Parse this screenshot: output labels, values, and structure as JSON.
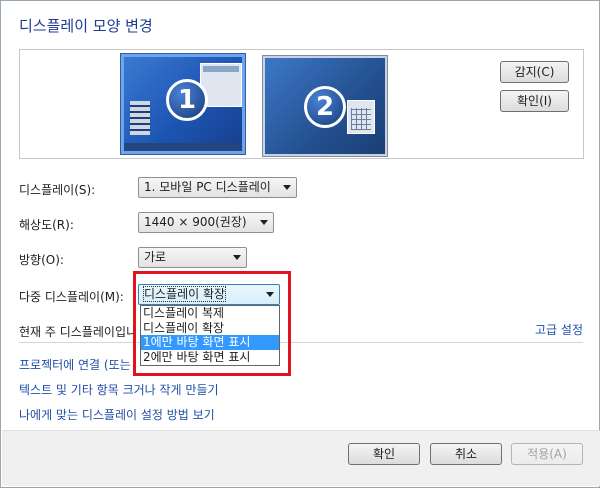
{
  "title": "디스플레이 모양 변경",
  "monitors": [
    {
      "number": "1",
      "selected": true
    },
    {
      "number": "2",
      "selected": false
    }
  ],
  "buttons": {
    "detect": "감지(C)",
    "identify": "확인(I)"
  },
  "fields": {
    "display": {
      "label": "디스플레이(S):",
      "value": "1. 모바일 PC 디스플레이"
    },
    "resolution": {
      "label": "해상도(R):",
      "value": "1440 × 900(권장)"
    },
    "orientation": {
      "label": "방향(O):",
      "value": "가로"
    },
    "multiple": {
      "label": "다중 디스플레이(M):",
      "value": "디스플레이 확장"
    }
  },
  "dropdown_options": [
    "디스플레이 복제",
    "디스플레이 확장",
    "1에만 바탕 화면 표시",
    "2에만 바탕 화면 표시"
  ],
  "dropdown_selected_index": 2,
  "main_display_text": "현재 주 디스플레이입니",
  "advanced_link": "고급 설정",
  "links": {
    "projector": "프로젝터에 연결 (또는",
    "text_size": "텍스트 및 기타 항목 크거나 작게 만들기",
    "help": "나에게 맞는 디스플레이 설정 방법 보기"
  },
  "footer": {
    "ok": "확인",
    "cancel": "취소",
    "apply": "적용(A)"
  },
  "colors": {
    "title": "#1f3a93",
    "link": "#1f4fa8",
    "highlight": "#3399ff",
    "annotation": "#e0141e"
  }
}
